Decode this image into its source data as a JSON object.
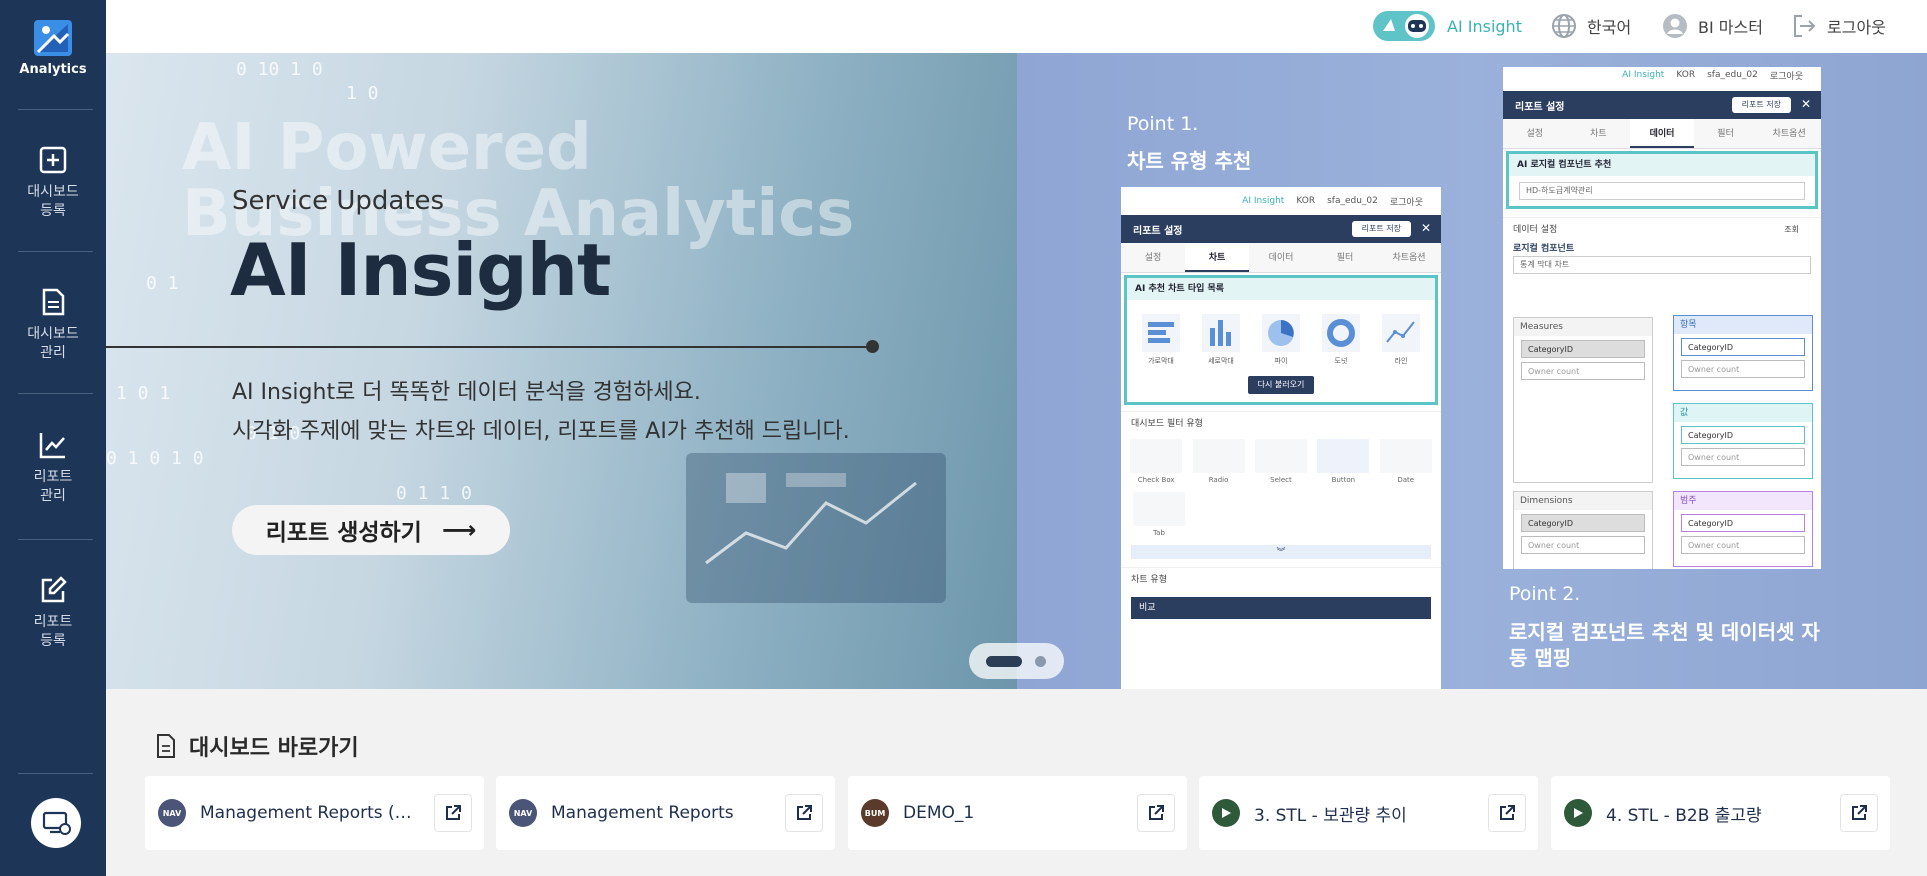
{
  "app": {
    "name": "Analytics"
  },
  "sidebar": {
    "items": [
      {
        "label": "대시보드\n등록",
        "icon": "plus-square-icon"
      },
      {
        "label": "대시보드\n관리",
        "icon": "document-icon"
      },
      {
        "label": "리포트\n관리",
        "icon": "line-chart-icon"
      },
      {
        "label": "리포트\n등록",
        "icon": "edit-icon"
      }
    ],
    "bottom_icon": "monitor-settings-icon"
  },
  "topbar": {
    "ai_insight": "AI Insight",
    "language": "한국어",
    "user": "BI 마스터",
    "logout": "로그아웃"
  },
  "hero": {
    "bg_text": "AI Powered\nBusiness Analytics",
    "service": "Service Updates",
    "title": "AI Insight",
    "desc1": "AI Insight로 더 똑똑한 데이터 분석을 경험하세요.",
    "desc2": "시각화 주제에 맞는 차트와 데이터, 리포트를 AI가 추천해 드립니다.",
    "cta": "리포트 생성하기",
    "digits": [
      "0  10 1 0",
      "0 1",
      "1 0 1",
      "0  1  0",
      "0 1 0  1 0",
      "1 0",
      "0 1 1 0"
    ],
    "point1_label": "Point 1.",
    "point1_title": "차트 유형 추천",
    "point2_label": "Point 2.",
    "point2_title": "로지컬 컴포넌트 추천 및 데이터셋 자\n동 맵핑"
  },
  "mock1": {
    "top": [
      "AI Insight",
      "KOR",
      "sfa_edu_02",
      "로그아웃"
    ],
    "header": "리포트 설정",
    "save": "리포트 저장",
    "tabs": [
      "설정",
      "차트",
      "데이터",
      "필터",
      "차트옵션"
    ],
    "active_tab": 1,
    "ai_box_title": "AI 추천 차트 타입 목록",
    "chart_types": [
      "가로막대",
      "세로막대",
      "파이",
      "도넛",
      "라인"
    ],
    "reload": "다시 불러오기",
    "filter_section": "대시보드 필터 유형",
    "filters": [
      "Check Box",
      "Radio",
      "Select",
      "Button",
      "Date"
    ],
    "filter_tab": "Tab",
    "filter_select": "Select",
    "filter_button": "Button",
    "filter_date": "Date",
    "chart_section": "차트 유형",
    "chart_bar": "비교"
  },
  "mock2": {
    "top": [
      "AI Insight",
      "KOR",
      "sfa_edu_02",
      "로그아웃"
    ],
    "header": "리포트 설정",
    "save": "리포트 저장",
    "tabs": [
      "설정",
      "차트",
      "데이터",
      "필터",
      "차트옵션"
    ],
    "active_tab": 2,
    "ai_box_title": "AI 로지컬 컴포넌트 추천",
    "ai_select": "HD-하도급계약관리",
    "data_section": "데이터 설정",
    "data_query": "조회",
    "logical": "로지컬 컴포넌트",
    "logical_select": "통계 막대 차트",
    "measures": "Measures",
    "dimensions": "Dimensions",
    "item_label": "항목",
    "value_label": "값",
    "category_label": "범주",
    "field": "CategoryID",
    "placeholder": "Owner count"
  },
  "shortcuts": {
    "title": "대시보드 바로가기",
    "cards": [
      {
        "badge": "NAV",
        "name": "Management Reports (Mobile)",
        "color": "#4a5577"
      },
      {
        "badge": "NAV",
        "name": "Management Reports",
        "color": "#4a5577"
      },
      {
        "badge": "BUM",
        "name": "DEMO_1",
        "color": "#5a3a2a"
      },
      {
        "badge": "",
        "name": "3. STL - 보관량 추이",
        "color": "#2f5a3a"
      },
      {
        "badge": "",
        "name": "4. STL - B2B 출고량",
        "color": "#2f5a3a"
      }
    ]
  }
}
